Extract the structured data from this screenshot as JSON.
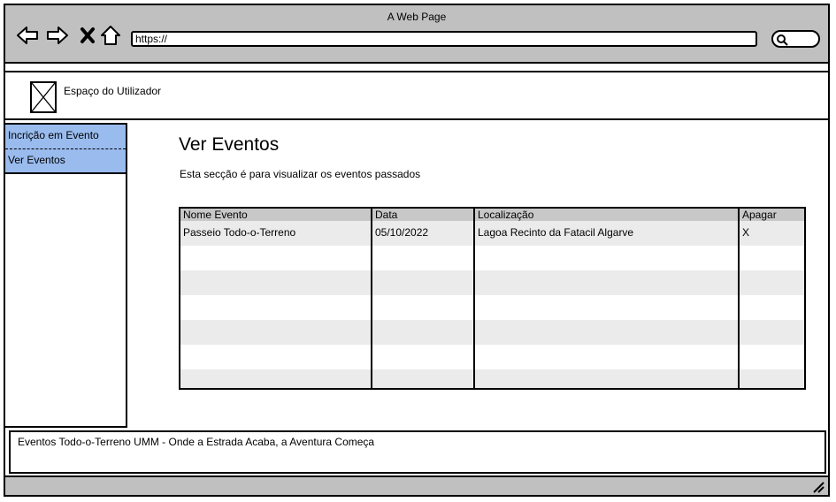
{
  "window": {
    "title": "A Web Page"
  },
  "browser": {
    "url": "https://"
  },
  "header": {
    "title": "Espaço do Utilizador"
  },
  "sidebar": {
    "items": [
      {
        "label": "Incrição em Evento"
      },
      {
        "label": "Ver Eventos"
      }
    ]
  },
  "main": {
    "title": "Ver Eventos",
    "description": "Esta secção é para visualizar os eventos passados"
  },
  "table": {
    "columns": [
      "Nome Evento",
      "Data",
      "Localização",
      "Apagar"
    ],
    "rows": [
      [
        "Passeio Todo-o-Terreno",
        "05/10/2022",
        "Lagoa Recinto da Fatacil Algarve",
        "X"
      ]
    ]
  },
  "footer": {
    "text": "Eventos Todo-o-Terreno UMM - Onde a Estrada Acaba, a Aventura Começa"
  },
  "colors": {
    "chrome": "#c0c0c0",
    "sidebar_selected": "#99bbee",
    "table_header": "#c8c8c8",
    "row_alt": "#ebebeb"
  }
}
